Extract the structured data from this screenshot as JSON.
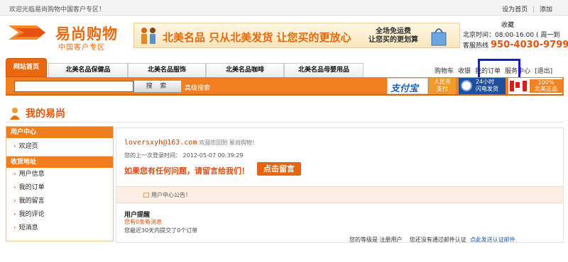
{
  "topbar": {
    "welcome": "欢迎光临易尚购物中国客户专区！",
    "set_home": "设为首页",
    "separator": "|",
    "add_fav": "添加"
  },
  "logo": {
    "name": "易尚购物",
    "subtitle": "中国客户专区"
  },
  "banner": {
    "slogan": "北美名品 只从北美发货 让您买的更放心",
    "shipping_line1": "全场免运费",
    "shipping_line2": "让您买的更划算"
  },
  "contact": {
    "fav": "收藏",
    "time": "北京时间：08:00-16:00 ( 周一到",
    "hotline_label": "客服热线",
    "phone": "950-4030-9799"
  },
  "nav": {
    "home": "网站首页",
    "tabs": [
      "北美名品保健品",
      "北美名品服饰",
      "北美名品咖啡",
      "北美名品母婴用品"
    ],
    "cart": "购物车",
    "favorites": "收银",
    "my_orders": "我的订单",
    "service": "服务中心",
    "logout": "[退出]"
  },
  "search": {
    "placeholder": "",
    "button": "搜 索",
    "advanced": "高级搜索"
  },
  "badges": {
    "alipay": "支付宝",
    "rmb_line1": "人民币",
    "rmb_line2": "支付",
    "express_line1": "24小时",
    "express_line2": "闪电发货",
    "canada_line1": "100%",
    "canada_line2": "北美正品"
  },
  "page_title": "我的易尚",
  "sidebar": {
    "section1": "用户中心",
    "welcome": "欢迎页",
    "section2": "收货地址",
    "items": [
      "用户信息",
      "我的订单",
      "我的留言",
      "我的评论",
      "短消息"
    ]
  },
  "main": {
    "username": "loversxyh@163.com",
    "greeting": "欢迎您回到 易尚购物！",
    "last_login": "您的上一次登录时间： 2012-05-07 00:39:29",
    "question": "如果您有任何问题，请留言给我们！",
    "message_btn": "点击留言",
    "notice": "用户中心公告！",
    "reminder_title": "用户提醒",
    "new_messages": "您有0条新消息",
    "recent_orders": "您最近30天内提交了0个订单",
    "level": "您的等级是 注册用户",
    "email_status": "您还没有通过邮件认证",
    "send_email": "点此发送认证邮件"
  },
  "colors": {
    "brand_orange": "#ea6a12",
    "nav_orange": "#f07f1f",
    "link_blue": "#1a5aa8",
    "highlight_box": "#1a1ae0"
  }
}
